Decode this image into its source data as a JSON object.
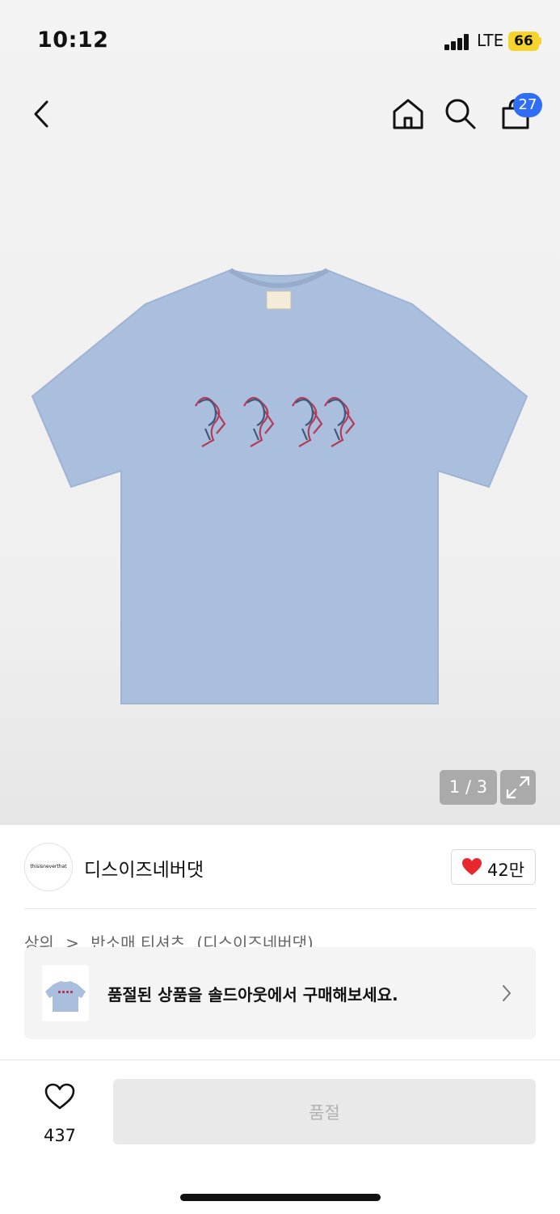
{
  "status_bar": {
    "time": "10:12",
    "network": "LTE",
    "battery": "66"
  },
  "header": {
    "cart_count": "27"
  },
  "gallery": {
    "counter": "1 / 3"
  },
  "brand": {
    "logo_text": "thisisneverthat",
    "name": "디스이즈네버댓",
    "likes": "42만"
  },
  "breadcrumb": [
    "상의",
    ">",
    "반소매 티셔츠",
    "(디스이즈네버댓)"
  ],
  "soldout_banner": {
    "text": "품절된 상품을 솔드아웃에서 구매해보세요."
  },
  "bottom_bar": {
    "wishlist_count": "437",
    "buy_button_label": "품절"
  },
  "colors": {
    "accent_blue": "#2f6df6",
    "like_red": "#e8282e",
    "battery_yellow": "#f6d42b",
    "tshirt_blue": "#a9bfdd"
  }
}
